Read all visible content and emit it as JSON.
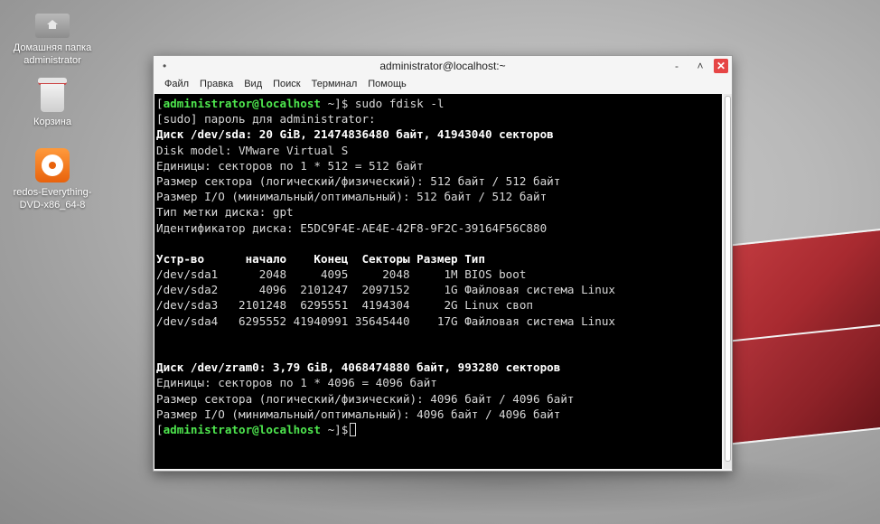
{
  "desktop": {
    "icons": [
      {
        "label_line1": "Домашняя папка",
        "label_line2": "administrator",
        "icon": "home-folder-icon"
      },
      {
        "label_line1": "Корзина",
        "label_line2": "",
        "icon": "trash-icon"
      },
      {
        "label_line1": "redos-Everything-",
        "label_line2": "DVD-x86_64-8",
        "icon": "disc-image-icon"
      }
    ]
  },
  "window": {
    "title": "administrator@localhost:~",
    "menu": [
      "Файл",
      "Правка",
      "Вид",
      "Поиск",
      "Терминал",
      "Помощь"
    ],
    "controls": {
      "minimize": "-",
      "maximize": "˄",
      "close": "✕"
    }
  },
  "terminal": {
    "prompt_user": "administrator@localhost",
    "prompt_dir": " ~]$",
    "command": " sudo fdisk -l",
    "lines": [
      {
        "text": "[sudo] пароль для administrator:",
        "bold": false
      },
      {
        "text": "Диск /dev/sda: 20 GiB, 21474836480 байт, 41943040 секторов",
        "bold": true
      },
      {
        "text": "Disk model: VMware Virtual S",
        "bold": false
      },
      {
        "text": "Единицы: секторов по 1 * 512 = 512 байт",
        "bold": false
      },
      {
        "text": "Размер сектора (логический/физический): 512 байт / 512 байт",
        "bold": false
      },
      {
        "text": "Размер I/O (минимальный/оптимальный): 512 байт / 512 байт",
        "bold": false
      },
      {
        "text": "Тип метки диска: gpt",
        "bold": false
      },
      {
        "text": "Идентификатор диска: E5DC9F4E-AE4E-42F8-9F2C-39164F56C880",
        "bold": false
      },
      {
        "text": "",
        "bold": false
      },
      {
        "text": "Устр-во      начало    Конец  Секторы Размер Тип",
        "bold": true
      },
      {
        "text": "/dev/sda1      2048     4095     2048     1M BIOS boot",
        "bold": false
      },
      {
        "text": "/dev/sda2      4096  2101247  2097152     1G Файловая система Linux",
        "bold": false
      },
      {
        "text": "/dev/sda3   2101248  6295551  4194304     2G Linux своп",
        "bold": false
      },
      {
        "text": "/dev/sda4   6295552 41940991 35645440    17G Файловая система Linux",
        "bold": false
      },
      {
        "text": "",
        "bold": false
      },
      {
        "text": "",
        "bold": false
      },
      {
        "text": "Диск /dev/zram0: 3,79 GiB, 4068474880 байт, 993280 секторов",
        "bold": true
      },
      {
        "text": "Единицы: секторов по 1 * 4096 = 4096 байт",
        "bold": false
      },
      {
        "text": "Размер сектора (логический/физический): 4096 байт / 4096 байт",
        "bold": false
      },
      {
        "text": "Размер I/O (минимальный/оптимальный): 4096 байт / 4096 байт",
        "bold": false
      }
    ]
  }
}
